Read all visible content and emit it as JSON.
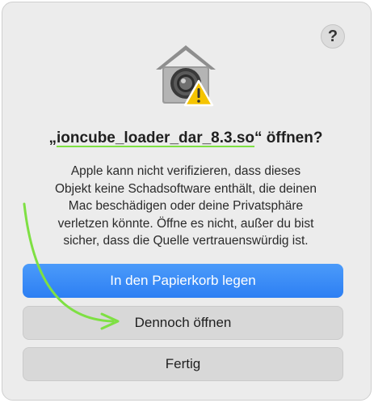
{
  "dialog": {
    "help_label": "?",
    "icon": "gatekeeper-security-warning-icon",
    "title_prefix": "„",
    "title_filename": "ioncube_loader_dar_8.3.so",
    "title_suffix": "“ öffnen?",
    "message_lines": [
      "Apple kann nicht verifizieren, dass dieses",
      "Objekt keine Schadsoftware enthält, die deinen",
      "Mac beschädigen oder deine Privatsphäre",
      "verletzen könnte. Öffne es nicht, außer du bist",
      "sicher, dass die Quelle vertrauenswürdig ist."
    ],
    "buttons": {
      "trash": "In den Papierkorb legen",
      "open_anyway": "Dennoch öffnen",
      "done": "Fertig"
    }
  },
  "colors": {
    "primary_button": "#2d7ff3",
    "annotation_green": "#7ee043",
    "warning_yellow": "#f5c400"
  }
}
